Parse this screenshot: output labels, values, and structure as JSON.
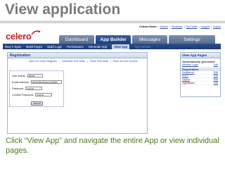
{
  "slide": {
    "title": "View application",
    "caption": "Click “View App” and navigate the entire App or view individual pages."
  },
  "colors": {
    "title": "#7a7a7a",
    "caption": "#4d7a1f",
    "brand_red": "#c81e1e",
    "nav_blue": "#1d3b74",
    "link_blue": "#2a4fa0"
  },
  "app": {
    "logo": "celero",
    "toplinks": {
      "user": "Celeroo Demo",
      "search": "Search",
      "feedback": "Feedback",
      "profile": "My Profile",
      "support": "Support",
      "logout": "Logout",
      "sep": "|"
    },
    "main_tabs": [
      {
        "label": "Dashboard",
        "active": false
      },
      {
        "label": "App Builder",
        "active": true
      },
      {
        "label": "Messages",
        "active": false
      },
      {
        "label": "Settings",
        "active": false
      }
    ],
    "sub_nav": [
      {
        "label": "Req 'n Spec",
        "active": false
      },
      {
        "label": "Build Pages",
        "active": false
      },
      {
        "label": "Build Logic",
        "active": false
      },
      {
        "label": "Permissions",
        "active": false
      },
      {
        "label": "Generate App",
        "active": false
      },
      {
        "label": "View App",
        "active": true
      },
      {
        "label": "App Version",
        "active": false
      }
    ],
    "registration": {
      "title": "Registration",
      "tools": [
        "View UX Entry Diagram",
        "Generate Text Data",
        "Clear Test Data",
        "Save as new version"
      ],
      "tool_sep": "|",
      "form": {
        "user_name_label": "User Name:",
        "user_name_value": "demo",
        "email_label": "Email Address:",
        "email_value": "demo@celeroo-builder",
        "password_label": "Password:",
        "password_value": "••••••••",
        "confirm_label": "Confirm Password:",
        "confirm_value": "••••••••",
        "submit_label": "Submit"
      }
    },
    "side_panel": {
      "title": "View App Pages",
      "auto_section": "Automatically generated",
      "auto_rows": [
        {
          "name": "Member Login",
          "action": "Edit"
        }
      ],
      "reg_section": "Registration",
      "reg_rows": [
        {
          "name": "Registered",
          "action": "Edit",
          "current": false
        },
        {
          "name": "Entry",
          "action": "Edit",
          "current": false
        },
        {
          "name": "Logout",
          "action": "Edit",
          "current": false
        },
        {
          "name": "registered",
          "action": "Edit",
          "current": true
        }
      ]
    }
  }
}
